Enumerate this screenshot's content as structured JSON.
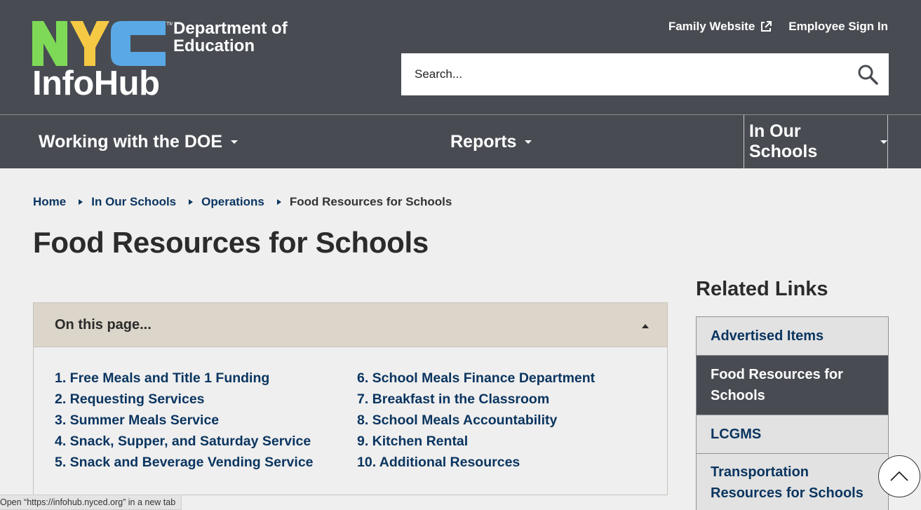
{
  "header": {
    "logo_nyc": "NYC",
    "logo_dept_line1": "Department of",
    "logo_dept_line2": "Education",
    "logo_infohub": "InfoHub",
    "family_website": "Family Website",
    "employee_sign_in": "Employee Sign In",
    "search_placeholder": "Search..."
  },
  "nav": {
    "items": [
      {
        "label": "Working with the DOE"
      },
      {
        "label": "Reports"
      },
      {
        "label": "In Our Schools"
      }
    ]
  },
  "breadcrumb": {
    "items": [
      "Home",
      "In Our Schools",
      "Operations"
    ],
    "current": "Food Resources for Schools"
  },
  "page_title": "Food Resources for Schools",
  "on_this_page": {
    "heading": "On this page...",
    "col1": [
      "1. Free Meals and Title 1 Funding",
      "2. Requesting Services",
      "3. Summer Meals Service",
      "4. Snack, Supper, and Saturday Service",
      "5. Snack and Beverage Vending Service"
    ],
    "col2": [
      "6. School Meals Finance Department",
      "7. Breakfast in the Classroom",
      "8. School Meals Accountability",
      "9. Kitchen Rental",
      "10. Additional Resources"
    ]
  },
  "related_links": {
    "title": "Related Links",
    "items": [
      {
        "label": "Advertised Items"
      },
      {
        "label": "Food Resources for Schools"
      },
      {
        "label": "LCGMS"
      },
      {
        "label": "Transportation Resources for Schools"
      }
    ]
  },
  "status_bar": "Open “https://infohub.nyced.org” in a new tab",
  "colors": {
    "header_bg": "#484c52",
    "link": "#0b3560",
    "accordion_header": "#dcd5c9",
    "nyc_green": "#7ed957",
    "nyc_blue": "#5aa9e6"
  }
}
